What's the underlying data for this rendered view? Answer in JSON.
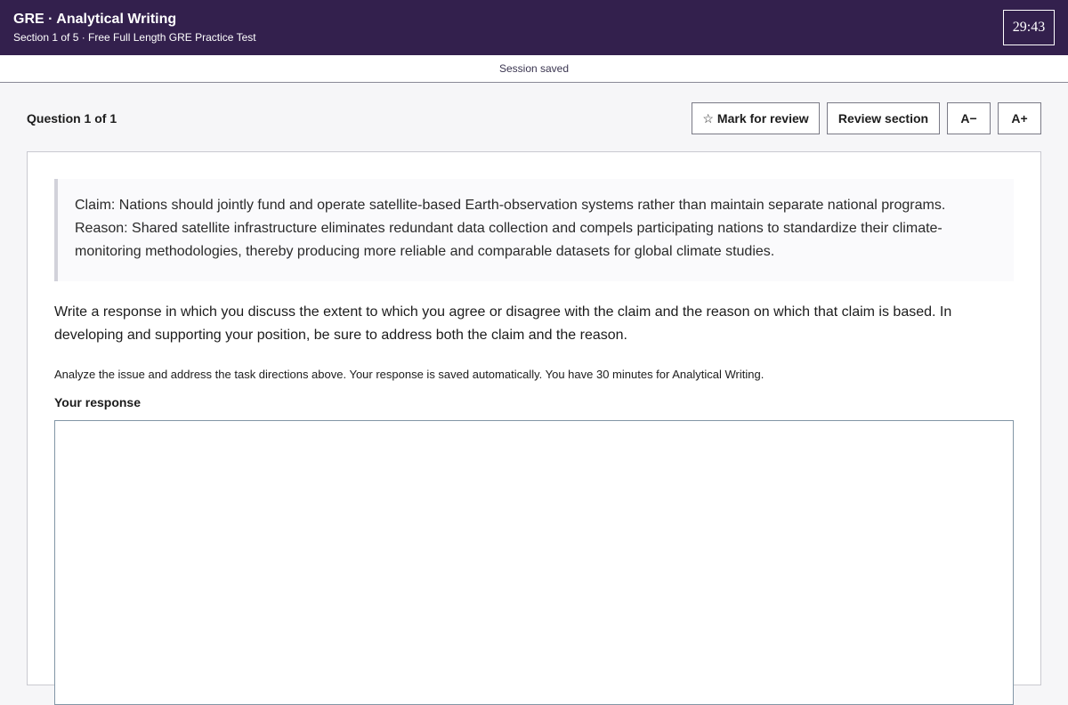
{
  "header": {
    "title": "GRE · Analytical Writing",
    "subtitle": "Section 1 of 5 · Free Full Length GRE Practice Test",
    "timer": "29:43"
  },
  "status": {
    "text": "Session saved"
  },
  "question": {
    "label": "Question 1 of 1"
  },
  "toolbar": {
    "mark_icon": "☆",
    "mark_label": "Mark for review",
    "review_label": "Review section",
    "font_decrease_label": "A−",
    "font_increase_label": "A+"
  },
  "stimulus": {
    "claim": "Claim: Nations should jointly fund and operate satellite-based Earth-observation systems rather than maintain separate national programs.",
    "reason": "Reason: Shared satellite infrastructure eliminates redundant data collection and compels participating nations to standardize their climate-monitoring methodologies, thereby producing more reliable and comparable datasets for global climate studies."
  },
  "prompt": {
    "text": "Write a response in which you discuss the extent to which you agree or disagree with the claim and the reason on which that claim is based. In developing and supporting your position, be sure to address both the claim and the reason."
  },
  "instructions": {
    "text": "Analyze the issue and address the task directions above. Your response is saved automatically. You have 30 minutes for Analytical Writing."
  },
  "response": {
    "label": "Your response",
    "value": ""
  }
}
